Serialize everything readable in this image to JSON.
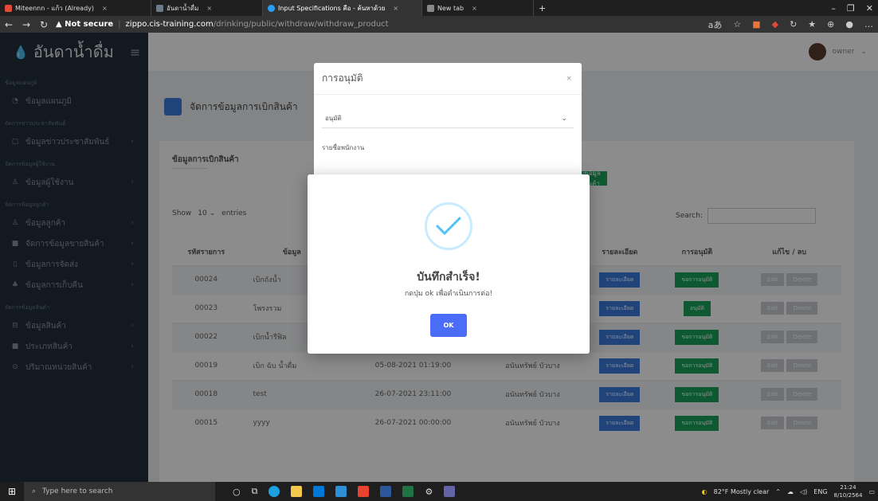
{
  "browser": {
    "tabs": [
      {
        "label": "Miteennn - แก้ว (Already)",
        "color": "#e04a3a"
      },
      {
        "label": "อันดาน้ำดื่ม",
        "color": "#6c7a89"
      },
      {
        "label": "Input Specifications คือ - ค้นหาด้วย",
        "color": "#2a9df4"
      },
      {
        "label": "New tab",
        "color": "#888888"
      }
    ],
    "new_tab": "+",
    "security": "▲ Not secure",
    "url_host": "zippo.cis-training.com",
    "url_path": "/drinking/public/withdraw/withdraw_product"
  },
  "sidebar": {
    "brand": "อันดาน้ำดื่ม",
    "sections": [
      {
        "title": "ข้อมูลแผนภูมิ",
        "items": [
          {
            "label": "ข้อมูลแผนภูมิ",
            "icon": "pie-icon",
            "arrow": false
          }
        ]
      },
      {
        "title": "จัดการข่าวประชาสัมพันธ์",
        "items": [
          {
            "label": "ข้อมูลข่าวประชาสัมพันธ์",
            "icon": "doc-icon",
            "arrow": true
          }
        ]
      },
      {
        "title": "จัดการข้อมูลผู้ใช้งาน",
        "items": [
          {
            "label": "ข้อมูลผู้ใช้งาน",
            "icon": "user-icon",
            "arrow": true
          }
        ]
      },
      {
        "title": "จัดการข้อมูลลูกค้า",
        "items": [
          {
            "label": "ข้อมูลลูกค้า",
            "icon": "users-icon",
            "arrow": true
          },
          {
            "label": "จัดการข้อมูลขายสินค้า",
            "icon": "cart-icon",
            "arrow": true
          },
          {
            "label": "ข้อมูลการจัดส่ง",
            "icon": "truck-icon",
            "arrow": true
          },
          {
            "label": "ข้อมูลการเก็บคืน",
            "icon": "return-icon",
            "arrow": true
          }
        ]
      },
      {
        "title": "จัดการข้อมูลสินค้า",
        "items": [
          {
            "label": "ข้อมูลสินค้า",
            "icon": "box-icon",
            "arrow": true
          },
          {
            "label": "ประเภทสินค้า",
            "icon": "tag-icon",
            "arrow": true
          },
          {
            "label": "ปริมาณหน่วยสินค้า",
            "icon": "scale-icon",
            "arrow": true
          }
        ]
      }
    ]
  },
  "topnav": {
    "user": "owner"
  },
  "page": {
    "title": "จัดการข้อมูลการเบิกสินค้า",
    "card_title": "ข้อมูลการเบิกสินค้า",
    "add_button": "เพิ่มข้อมูลเบิกสินค้า",
    "show_label": "Show",
    "entries_value": "10",
    "entries_label": "entries",
    "search_label": "Search:"
  },
  "table": {
    "headers": [
      "รหัสรายการ",
      "ข้อมูล",
      "",
      "",
      "รายละเอียด",
      "การอนุมัติ",
      "แก้ไข / ลบ"
    ],
    "rows": [
      {
        "id": "00024",
        "info": "เบิกถังน้ำ",
        "date": "",
        "user": "",
        "status": "ขอการอนุมัติ",
        "status_color": "green"
      },
      {
        "id": "00023",
        "info": "โพรงรวม",
        "date": "",
        "user": "",
        "status": "อนุมัติ",
        "status_color": "green"
      },
      {
        "id": "00022",
        "info": "เบิกน้ำรีฟิล",
        "date": "",
        "user": "",
        "status": "ขอการอนุมัติ",
        "status_color": "green"
      },
      {
        "id": "00019",
        "info": "เบิก ฉับ น้ำดื่ม",
        "date": "05-08-2021 01:19:00",
        "user": "อนันทรัพย์ บัวบาง",
        "status": "ขอการอนุมัติ",
        "status_color": "green"
      },
      {
        "id": "00018",
        "info": "test",
        "date": "26-07-2021 23:11:00",
        "user": "อนันทรัพย์ บัวบาง",
        "status": "ขอการอนุมัติ",
        "status_color": "green"
      },
      {
        "id": "00015",
        "info": "yyyy",
        "date": "26-07-2021 00:00:00",
        "user": "อนันทรัพย์ บัวบาง",
        "status": "ขอการอนุมัติ",
        "status_color": "green"
      }
    ],
    "detail_label": "รายละเอียด",
    "edit_label": "Edit",
    "delete_label": "Delete"
  },
  "approval_modal": {
    "title": "การอนุมัติ",
    "close": "×",
    "select_value": "อนุมัติ",
    "employee_label": "รายชื่อพนักงาน"
  },
  "success_modal": {
    "title": "บันทึกสำเร็จ!",
    "subtitle": "กดปุ่ม ok เพื่อดำเนินการต่อ!",
    "ok": "OK"
  },
  "taskbar": {
    "search_placeholder": "Type here to search",
    "weather": "82°F  Mostly clear",
    "lang": "ENG",
    "time": "21:24",
    "date": "8/10/2564"
  }
}
